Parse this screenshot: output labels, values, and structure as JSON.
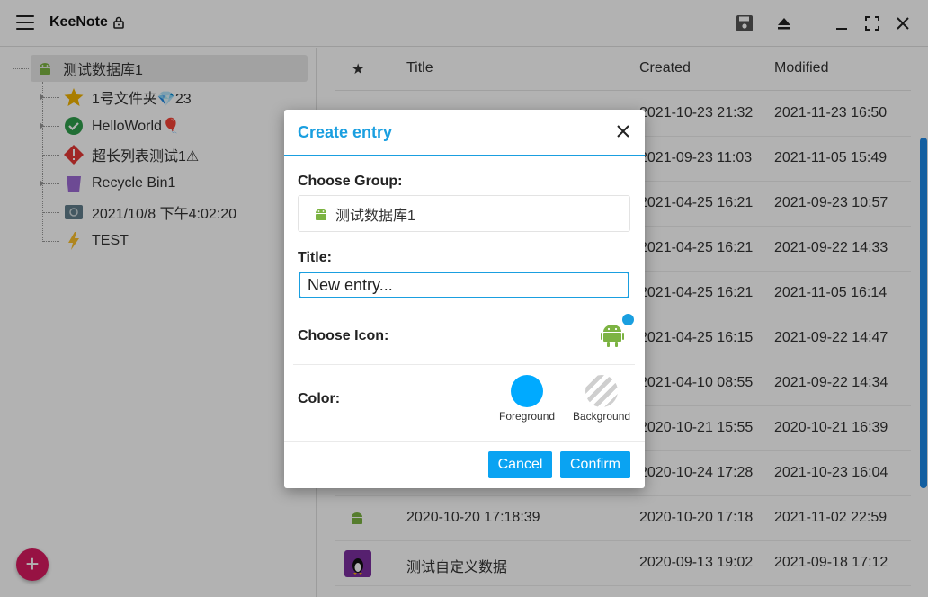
{
  "app": {
    "title": "KeeNote"
  },
  "tree": {
    "root": "测试数据库1",
    "items": [
      {
        "label": "1号文件夹💎23",
        "icon": "star-icon"
      },
      {
        "label": "HelloWorld🎈",
        "icon": "check-circle-icon"
      },
      {
        "label": "超长列表测试1⚠",
        "icon": "warning-diamond-icon"
      },
      {
        "label": "Recycle Bin1",
        "icon": "trash-icon"
      },
      {
        "label": "2021/10/8 下午4:02:20",
        "icon": "safe-icon"
      },
      {
        "label": "TEST",
        "icon": "lightning-icon"
      }
    ]
  },
  "table": {
    "headers": {
      "star": "★",
      "title": "Title",
      "created": "Created",
      "modified": "Modified"
    },
    "rows": [
      {
        "title": "",
        "created": "2021-10-23 21:32",
        "modified": "2021-11-23 16:50"
      },
      {
        "title": "",
        "created": "2021-09-23 11:03",
        "modified": "2021-11-05 15:49"
      },
      {
        "title": "",
        "created": "2021-04-25 16:21",
        "modified": "2021-09-23 10:57"
      },
      {
        "title": "",
        "created": "2021-04-25 16:21",
        "modified": "2021-09-22 14:33"
      },
      {
        "title": "",
        "created": "2021-04-25 16:21",
        "modified": "2021-11-05 16:14"
      },
      {
        "title": "",
        "created": "2021-04-25 16:15",
        "modified": "2021-09-22 14:47"
      },
      {
        "title": "",
        "created": "2021-04-10 08:55",
        "modified": "2021-09-22 14:34"
      },
      {
        "title": "",
        "created": "2020-10-21 15:55",
        "modified": "2020-10-21 16:39"
      },
      {
        "title": "",
        "created": "2020-10-24 17:28",
        "modified": "2021-10-23 16:04"
      },
      {
        "title": "2020-10-20 17:18:39",
        "created": "2020-10-20 17:18",
        "modified": "2021-11-02 22:59"
      },
      {
        "title": "测试自定义数据",
        "created": "2020-09-13 19:02",
        "modified": "2021-09-18 17:12"
      }
    ]
  },
  "dialog": {
    "title": "Create entry",
    "choose_group_label": "Choose Group:",
    "group_value": "测试数据库1",
    "title_label": "Title:",
    "title_value": "New entry...",
    "choose_icon_label": "Choose Icon:",
    "color_label": "Color:",
    "foreground_label": "Foreground",
    "background_label": "Background",
    "cancel_label": "Cancel",
    "confirm_label": "Confirm"
  },
  "colors": {
    "accent": "#1a9fe0",
    "button": "#0aa3f2",
    "android": "#7cb342",
    "fab": "#d81b60",
    "foreground_swatch": "#00aaff"
  }
}
